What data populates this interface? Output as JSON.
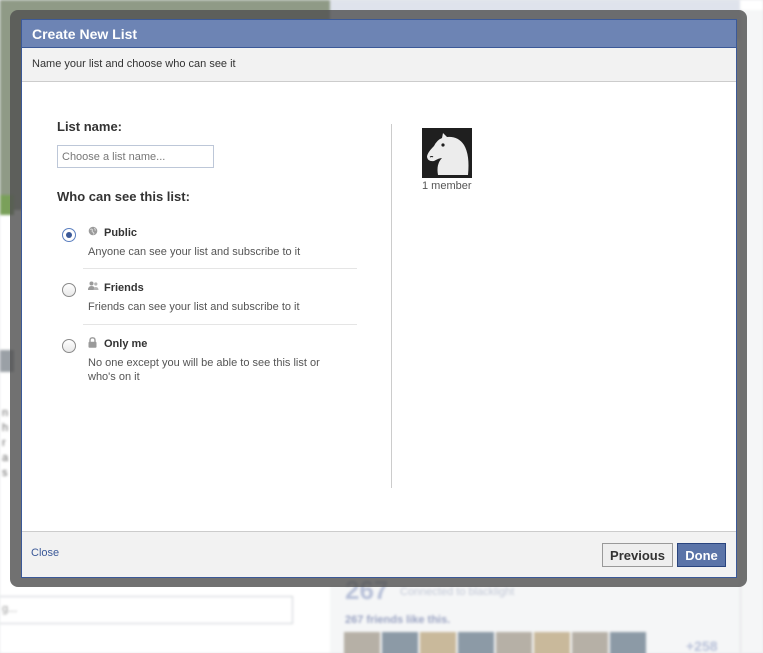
{
  "dialog": {
    "title": "Create New List",
    "subtitle": "Name your list and choose who can see it"
  },
  "form": {
    "list_name_label": "List name:",
    "list_name_placeholder": "Choose a list name...",
    "list_name_value": "",
    "visibility_label": "Who can see this list:",
    "selected_option": "public",
    "options": [
      {
        "id": "public",
        "title": "Public",
        "description": "Anyone can see your list and subscribe to it",
        "icon": "globe-icon",
        "checked": true
      },
      {
        "id": "friends",
        "title": "Friends",
        "description": "Friends can see your list and subscribe to it",
        "icon": "friends-icon",
        "checked": false
      },
      {
        "id": "only-me",
        "title": "Only me",
        "description": "No one except you will be able to see this list or who's on it",
        "icon": "lock-icon",
        "checked": false
      }
    ]
  },
  "members": {
    "count_label": "1 member",
    "avatar_icon": "knight-chess-piece-icon"
  },
  "footer": {
    "close_label": "Close",
    "previous_label": "Previous",
    "done_label": "Done"
  },
  "background": {
    "search_placeholder": "g...",
    "friend_count": "267",
    "connected_text": "Connected to blacklight",
    "friends_like_text": "267 friends like this.",
    "more_count": "+258",
    "fragment_letters": [
      "n h",
      "r a",
      "s"
    ]
  },
  "colors": {
    "titlebar": "#6d84b4",
    "brand_blue": "#3b5998",
    "done_button": "#5b74a8",
    "footer_bg": "#f2f2f2"
  }
}
